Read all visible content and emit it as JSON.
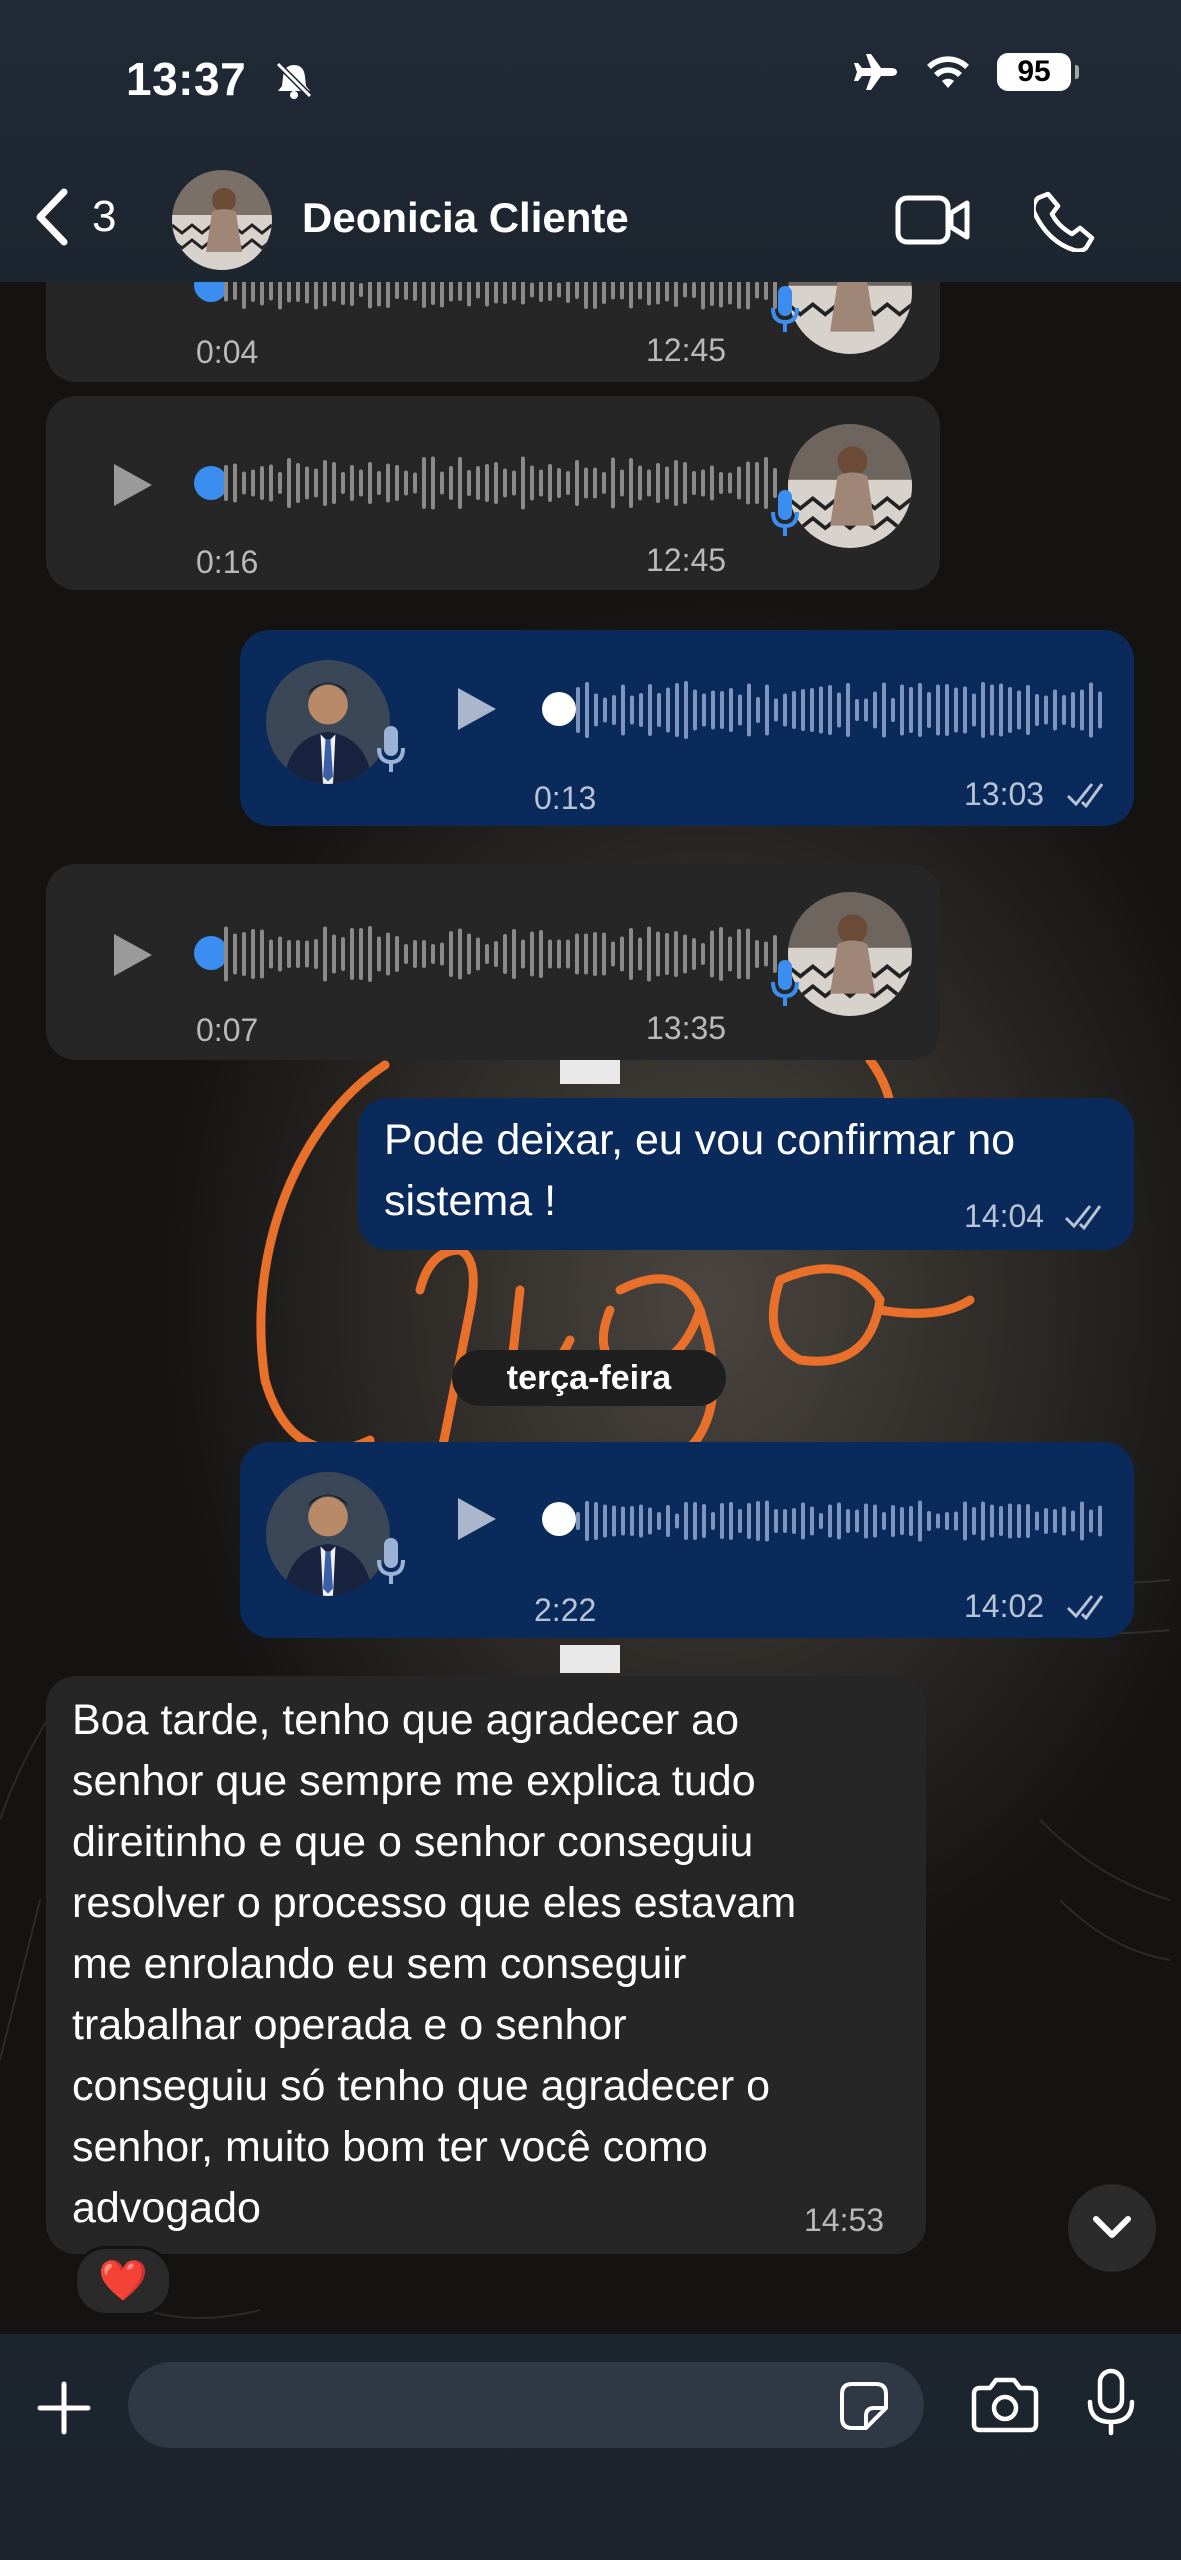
{
  "status_bar": {
    "time": "13:37",
    "battery": "95"
  },
  "header": {
    "back_count": "3",
    "contact_name": "Deonicia Cliente"
  },
  "messages": [
    {
      "type": "voice",
      "direction": "in",
      "duration": "0:04",
      "time": "12:45"
    },
    {
      "type": "voice",
      "direction": "in",
      "duration": "0:16",
      "time": "12:45"
    },
    {
      "type": "voice",
      "direction": "out",
      "duration": "0:13",
      "time": "13:03"
    },
    {
      "type": "voice",
      "direction": "in",
      "duration": "0:07",
      "time": "13:35"
    },
    {
      "type": "text",
      "direction": "out",
      "lines": [
        "Pode deixar, eu vou confirmar no",
        "sistema !"
      ],
      "time": "14:04"
    },
    {
      "type": "day",
      "label": "terça-feira"
    },
    {
      "type": "voice",
      "direction": "out",
      "duration": "2:22",
      "time": "14:02"
    },
    {
      "type": "text",
      "direction": "in",
      "lines": [
        "Boa tarde, tenho que agradecer ao",
        "senhor que sempre me explica tudo",
        "direitinho e que o senhor conseguiu",
        "resolver o processo que eles estavam",
        "me enrolando eu sem conseguir",
        "trabalhar operada e o senhor",
        "conseguiu só tenho que agradecer o",
        "senhor, muito bom ter você como",
        "advogado"
      ],
      "time": "14:53",
      "reaction": "❤️"
    }
  ],
  "input": {
    "placeholder": ""
  },
  "colors": {
    "incoming": "#262626",
    "outgoing": "#0a2a5c",
    "accent_blue": "#3b8ef0",
    "wallpaper_neon": "#e8702a"
  },
  "icons": [
    "bell-slash-icon",
    "airplane-icon",
    "wifi-icon",
    "back-chevron-icon",
    "video-call-icon",
    "phone-icon",
    "play-icon",
    "mic-icon",
    "read-check-icon",
    "chevron-down-icon",
    "plus-icon",
    "sticker-icon",
    "camera-icon",
    "microphone-icon"
  ]
}
